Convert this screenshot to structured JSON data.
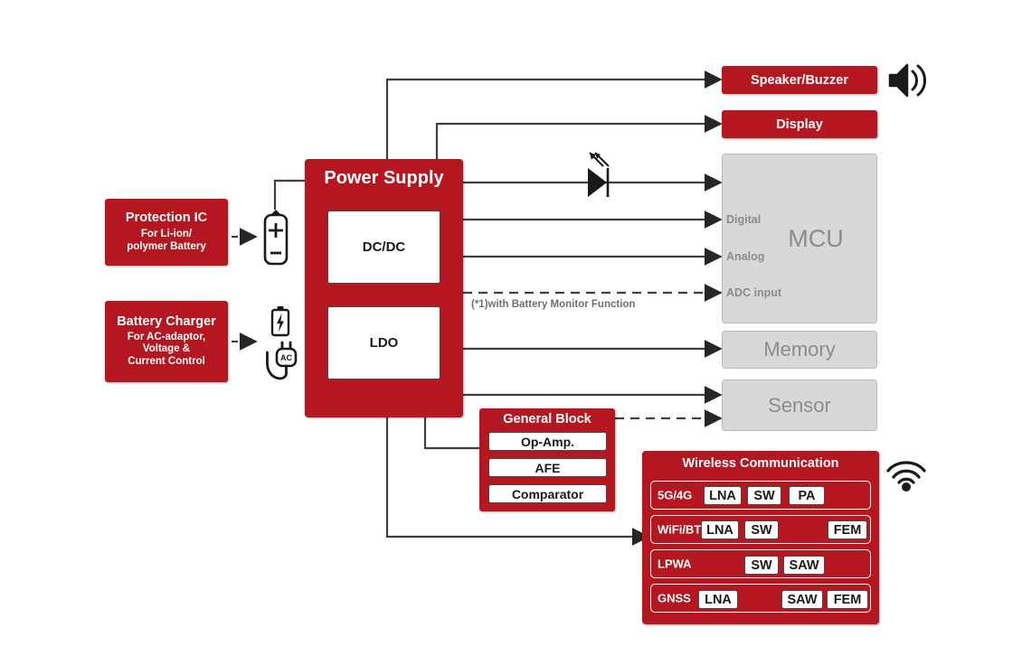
{
  "diagram": {
    "title_blocks": {
      "power_supply": {
        "label": "Power Supply",
        "children": [
          {
            "label": "DC/DC"
          },
          {
            "label": "LDO"
          }
        ]
      },
      "protection_ic": {
        "title": "Protection IC",
        "sub_line1": "For Li-ion/",
        "sub_line2": "polymer Battery"
      },
      "battery_charger": {
        "title": "Battery Charger",
        "sub_line1": "For AC-adaptor,",
        "sub_line2": "Voltage &",
        "sub_line3": "Current Control"
      },
      "speaker_buzzer": {
        "label": "Speaker/Buzzer"
      },
      "display": {
        "label": "Display"
      },
      "mcu": {
        "label": "MCU",
        "ports": [
          "Digital",
          "Analog",
          "ADC input"
        ]
      },
      "memory": {
        "label": "Memory"
      },
      "sensor": {
        "label": "Sensor"
      },
      "general_block": {
        "label": "General Block",
        "children": [
          {
            "label": "Op-Amp."
          },
          {
            "label": "AFE"
          },
          {
            "label": "Comparator"
          }
        ]
      },
      "wireless": {
        "label": "Wireless Communication",
        "rows": [
          {
            "name": "5G/4G",
            "parts": [
              "LNA",
              "SW",
              "PA"
            ]
          },
          {
            "name": "WiFi/BT",
            "parts": [
              "LNA",
              "SW",
              "FEM"
            ]
          },
          {
            "name": "LPWA",
            "parts": [
              "SW",
              "SAW"
            ]
          },
          {
            "name": "GNSS",
            "parts": [
              "LNA",
              "SAW",
              "FEM"
            ]
          }
        ]
      }
    },
    "annotations": {
      "battery_monitor_note": "(*1)with Battery Monitor Function",
      "ac_plug_label": "AC"
    },
    "icons": {
      "battery": "battery-icon",
      "charging_battery": "charging-battery-icon",
      "ac_plug": "ac-plug-icon",
      "led": "led-diode-icon",
      "speaker": "speaker-icon",
      "antenna": "wifi-antenna-icon"
    },
    "colors": {
      "brand_red": "#B51721",
      "grey_block": "#D8D8D8",
      "grey_text": "#8C8C8C",
      "wire": "#404040"
    }
  }
}
